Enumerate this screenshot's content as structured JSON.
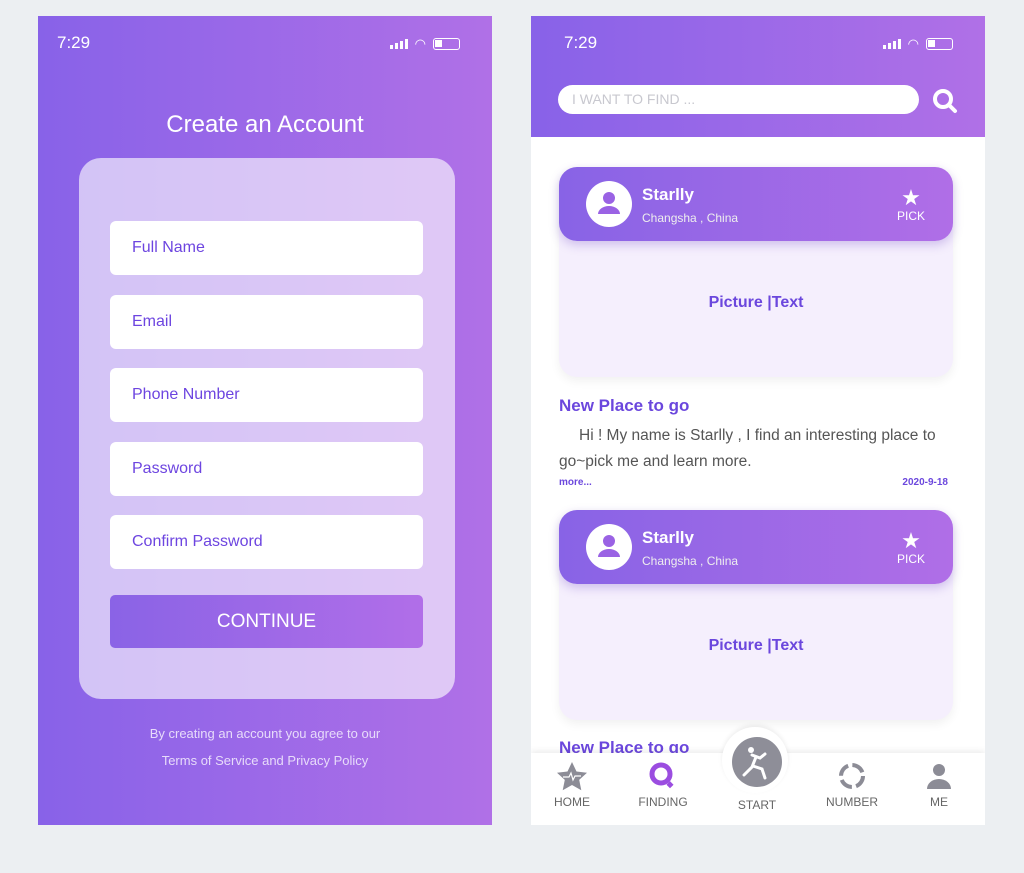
{
  "status": {
    "time": "7:29"
  },
  "signup": {
    "title": "Create an Account",
    "fields": [
      "Full Name",
      "Email",
      "Phone Number",
      "Password",
      "Confirm Password"
    ],
    "continue": "CONTINUE",
    "footer_line1": "By creating an account you agree to our",
    "footer_line2": "Terms of Service and Privacy Policy"
  },
  "feed": {
    "search_placeholder": "I WANT TO FIND ...",
    "posts": [
      {
        "name": "Starlly",
        "location": "Changsha , China",
        "pick": "PICK",
        "media": "Picture |Text",
        "heading": "New Place to go",
        "body": "Hi ! My name is Starlly , I find an interesting place to go~pick me and learn more.",
        "more": "more...",
        "date": "2020-9-18"
      },
      {
        "name": "Starlly",
        "location": "Changsha , China",
        "pick": "PICK",
        "media": "Picture |Text",
        "heading": "New Place to go"
      }
    ],
    "nav": [
      "HOME",
      "FINDING",
      "START",
      "NUMBER",
      "ME"
    ]
  },
  "colors": {
    "accent": "#8862e8",
    "accent2": "#b070e7",
    "text": "#6b47dd"
  }
}
